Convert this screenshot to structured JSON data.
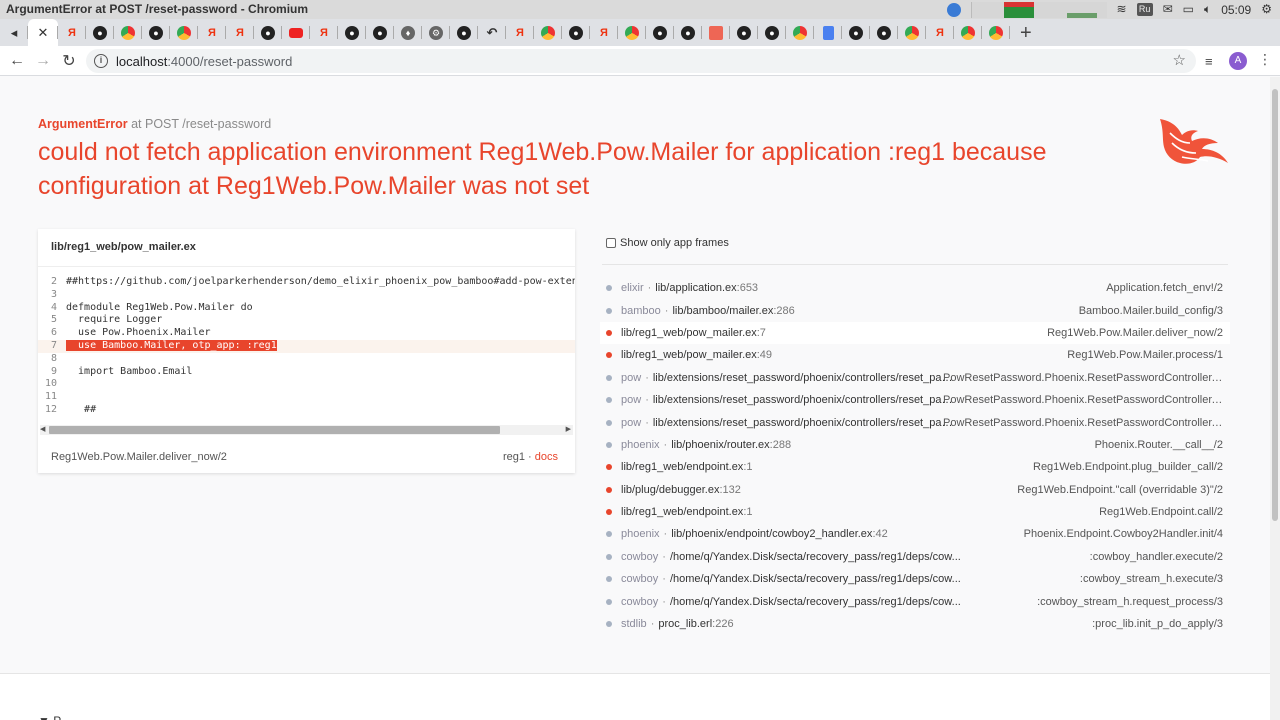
{
  "window": {
    "title": "ArgumentError at POST /reset-password - Chromium"
  },
  "tray": {
    "keyboard_layout": "Ru",
    "time": "05:09"
  },
  "tabs": [
    {
      "icon": "back-to-tab"
    },
    {
      "icon": "close"
    },
    {
      "icon": "yandex"
    },
    {
      "icon": "github"
    },
    {
      "icon": "chrome"
    },
    {
      "icon": "github"
    },
    {
      "icon": "chrome"
    },
    {
      "icon": "yandex"
    },
    {
      "icon": "yandex"
    },
    {
      "icon": "github"
    },
    {
      "icon": "youtube"
    },
    {
      "icon": "yandex"
    },
    {
      "icon": "github"
    },
    {
      "icon": "github"
    },
    {
      "icon": "mix"
    },
    {
      "icon": "settings"
    },
    {
      "icon": "github"
    },
    {
      "icon": "undo"
    },
    {
      "icon": "yandex"
    },
    {
      "icon": "chrome"
    },
    {
      "icon": "github"
    },
    {
      "icon": "yandex"
    },
    {
      "icon": "chrome"
    },
    {
      "icon": "github"
    },
    {
      "icon": "github"
    },
    {
      "icon": "gitlab"
    },
    {
      "icon": "github"
    },
    {
      "icon": "github"
    },
    {
      "icon": "chrome"
    },
    {
      "icon": "docs"
    },
    {
      "icon": "github"
    },
    {
      "icon": "github"
    },
    {
      "icon": "chrome"
    },
    {
      "icon": "yandex"
    },
    {
      "icon": "chrome"
    },
    {
      "icon": "chrome"
    }
  ],
  "url": {
    "host": "localhost",
    "path": ":4000/reset-password"
  },
  "error": {
    "type": "ArgumentError",
    "at": "at POST /reset-password",
    "message": "could not fetch application environment Reg1Web.Pow.Mailer for application :reg1 because configuration at Reg1Web.Pow.Mailer was not set"
  },
  "code_card": {
    "filename": "lib/reg1_web/pow_mailer.ex",
    "lines": [
      {
        "n": "2",
        "text": "##https://github.com/joelparkerhenderson/demo_elixir_phoenix_pow_bamboo#add-pow-extensi",
        "hl": false
      },
      {
        "n": "3",
        "text": "",
        "hl": false
      },
      {
        "n": "4",
        "text": "defmodule Reg1Web.Pow.Mailer do",
        "hl": false
      },
      {
        "n": "5",
        "text": "  require Logger",
        "hl": false
      },
      {
        "n": "6",
        "text": "  use Pow.Phoenix.Mailer",
        "hl": false
      },
      {
        "n": "7",
        "text": "  use Bamboo.Mailer, otp_app: :reg1",
        "hl": true
      },
      {
        "n": "8",
        "text": "",
        "hl": false
      },
      {
        "n": "9",
        "text": "  import Bamboo.Email",
        "hl": false
      },
      {
        "n": "10",
        "text": "",
        "hl": false
      },
      {
        "n": "11",
        "text": "",
        "hl": false
      },
      {
        "n": "12",
        "text": "   ##",
        "hl": false
      }
    ],
    "function": "Reg1Web.Pow.Mailer.deliver_now/2",
    "app": "reg1",
    "docs_label": "docs"
  },
  "frames_panel": {
    "checkbox_label": "Show only app frames",
    "frames": [
      {
        "lib": "elixir",
        "file": "lib/application.ex",
        "line": ":653",
        "fn": "Application.fetch_env!/2",
        "app": false,
        "active": false
      },
      {
        "lib": "bamboo",
        "file": "lib/bamboo/mailer.ex",
        "line": ":286",
        "fn": "Bamboo.Mailer.build_config/3",
        "app": false,
        "active": false
      },
      {
        "lib": "",
        "file": "lib/reg1_web/pow_mailer.ex",
        "line": ":7",
        "fn": "Reg1Web.Pow.Mailer.deliver_now/2",
        "app": true,
        "active": true
      },
      {
        "lib": "",
        "file": "lib/reg1_web/pow_mailer.ex",
        "line": ":49",
        "fn": "Reg1Web.Pow.Mailer.process/1",
        "app": true,
        "active": false
      },
      {
        "lib": "pow",
        "file": "lib/extensions/reset_password/phoenix/controllers/reset_pass...",
        "line": "",
        "fn": "PowResetPassword.Phoenix.ResetPasswordController.res...",
        "app": false,
        "active": false
      },
      {
        "lib": "pow",
        "file": "lib/extensions/reset_password/phoenix/controllers/reset_pass...",
        "line": "",
        "fn": "PowResetPassword.Phoenix.ResetPasswordController.acti...",
        "app": false,
        "active": false
      },
      {
        "lib": "pow",
        "file": "lib/extensions/reset_password/phoenix/controllers/reset_pass...",
        "line": "",
        "fn": "PowResetPassword.Phoenix.ResetPasswordController.pho...",
        "app": false,
        "active": false
      },
      {
        "lib": "phoenix",
        "file": "lib/phoenix/router.ex",
        "line": ":288",
        "fn": "Phoenix.Router.__call__/2",
        "app": false,
        "active": false
      },
      {
        "lib": "",
        "file": "lib/reg1_web/endpoint.ex",
        "line": ":1",
        "fn": "Reg1Web.Endpoint.plug_builder_call/2",
        "app": true,
        "active": false
      },
      {
        "lib": "",
        "file": "lib/plug/debugger.ex",
        "line": ":132",
        "fn": "Reg1Web.Endpoint.\"call (overridable 3)\"/2",
        "app": true,
        "active": false
      },
      {
        "lib": "",
        "file": "lib/reg1_web/endpoint.ex",
        "line": ":1",
        "fn": "Reg1Web.Endpoint.call/2",
        "app": true,
        "active": false
      },
      {
        "lib": "phoenix",
        "file": "lib/phoenix/endpoint/cowboy2_handler.ex",
        "line": ":42",
        "fn": "Phoenix.Endpoint.Cowboy2Handler.init/4",
        "app": false,
        "active": false
      },
      {
        "lib": "cowboy",
        "file": "/home/q/Yandex.Disk/secta/recovery_pass/reg1/deps/cow...",
        "line": "",
        "fn": ":cowboy_handler.execute/2",
        "app": false,
        "active": false
      },
      {
        "lib": "cowboy",
        "file": "/home/q/Yandex.Disk/secta/recovery_pass/reg1/deps/cow...",
        "line": "",
        "fn": ":cowboy_stream_h.execute/3",
        "app": false,
        "active": false
      },
      {
        "lib": "cowboy",
        "file": "/home/q/Yandex.Disk/secta/recovery_pass/reg1/deps/cow...",
        "line": "",
        "fn": ":cowboy_stream_h.request_process/3",
        "app": false,
        "active": false
      },
      {
        "lib": "stdlib",
        "file": "proc_lib.erl",
        "line": ":226",
        "fn": ":proc_lib.init_p_do_apply/3",
        "app": false,
        "active": false
      }
    ]
  },
  "colors": {
    "accent": "#e8452c",
    "frame_dot": "#a7b2c2"
  }
}
